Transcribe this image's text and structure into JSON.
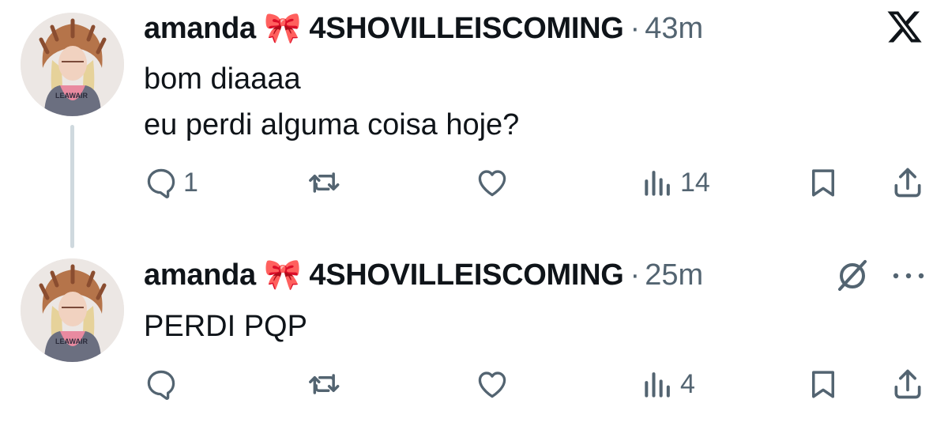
{
  "tweets": [
    {
      "display_name": "amanda",
      "name_emoji": "🎀",
      "name_suffix": "4SHOVILLEISCOMING",
      "separator": "·",
      "time": "43m",
      "lines": [
        "bom diaaaa",
        "eu perdi alguma coisa hoje?"
      ],
      "reply_count": "1",
      "view_count": "14"
    },
    {
      "display_name": "amanda",
      "name_emoji": "🎀",
      "name_suffix": "4SHOVILLEISCOMING",
      "separator": "·",
      "time": "25m",
      "lines": [
        "PERDI PQP"
      ],
      "reply_count": "",
      "view_count": "4"
    }
  ],
  "avatar_shirt_text": "LEAWAIR",
  "icons": {
    "top_right": "x-logo-icon",
    "grok": "grok-icon",
    "more": "more-icon"
  },
  "colors": {
    "text": "#0f1419",
    "secondary": "#536471",
    "thread_line": "#cfd9de"
  }
}
